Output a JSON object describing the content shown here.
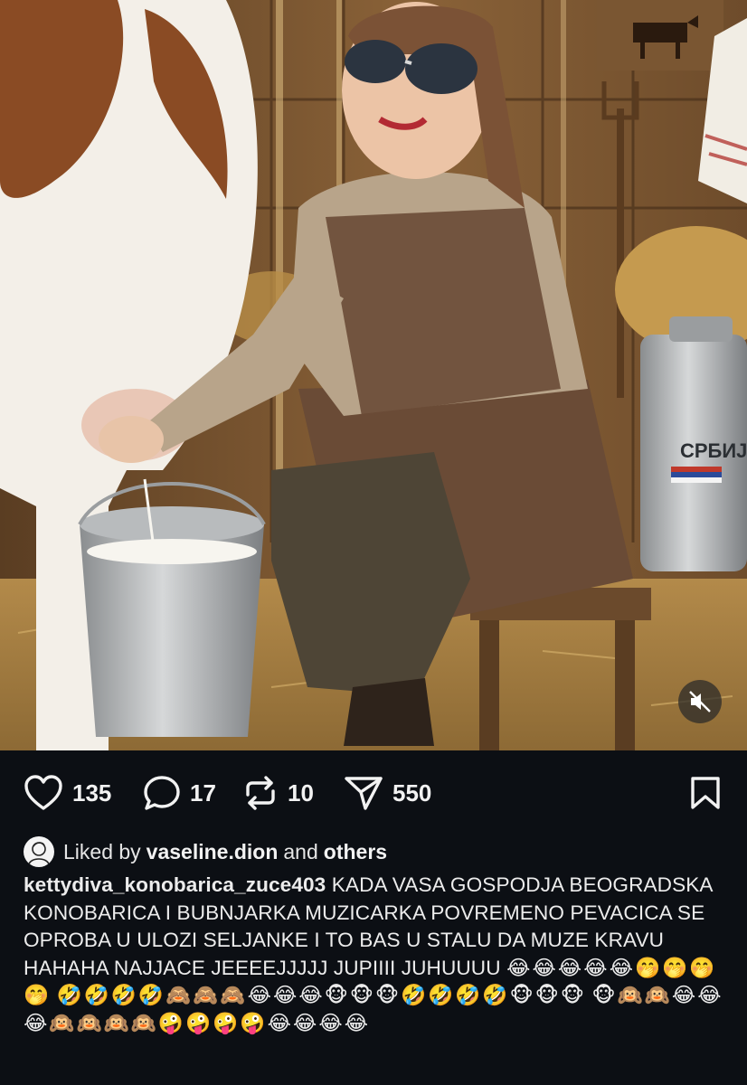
{
  "media": {
    "image_subject": "woman milking a cow in a barn",
    "milk_can_label": "СРБИЈА",
    "mute_icon": "speaker-muted-icon"
  },
  "actions": {
    "likes": "135",
    "comments": "17",
    "reposts": "10",
    "shares": "550",
    "icons": {
      "like": "heart-icon",
      "comment": "speech-bubble-icon",
      "repost": "repost-arrows-icon",
      "share": "paper-plane-icon",
      "save": "bookmark-icon"
    }
  },
  "liked_by": {
    "prefix": "Liked by",
    "user": "vaseline.dion",
    "conjunction": "and",
    "others": "others"
  },
  "caption": {
    "username": "kettydiva_konobarica_zuce403",
    "text": " KADA VASA GOSPODJA BEOGRADSKA KONOBARICA I BUBNJARKA MUZICARKA POVREMENO PEVACICA SE OPROBA U ULOZI SELJANKE I TO BAS U STALU DA MUZE KRAVU HAHAHA NAJJACE JEEEEJJJJJ JUPIIII JUHUUUU ",
    "emojis_1": "😂😂😂😂😂🤭🤭🤭🤭",
    "emojis_2": "🤣🤣🤣🤣🙈🙈🙈😂😂😂🐵🐵🐵🤣🤣🤣🤣🐵🐵🐵",
    "emojis_3": "🐵🙉🙉😂😂😂🙉🙉🙉🙉🤪🤪🤪🤪😂😂😂😂"
  },
  "colors": {
    "background": "#0c0f14",
    "text": "#f2f2f2"
  }
}
